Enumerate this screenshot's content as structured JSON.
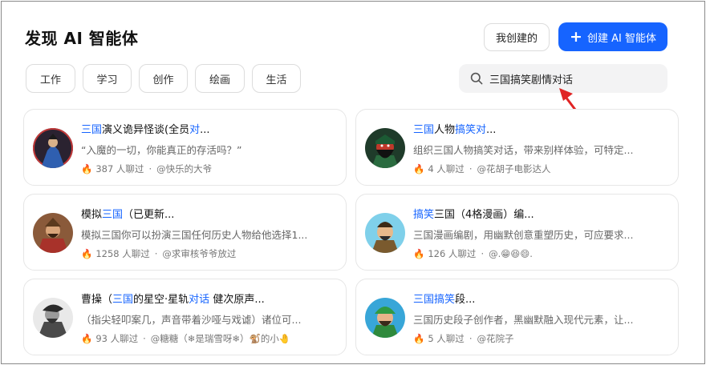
{
  "header": {
    "title": "发现 AI 智能体",
    "my_created_label": "我创建的",
    "create_label": "创建 AI 智能体"
  },
  "tabs": [
    {
      "label": "工作"
    },
    {
      "label": "学习"
    },
    {
      "label": "创作"
    },
    {
      "label": "绘画"
    },
    {
      "label": "生活"
    }
  ],
  "search": {
    "value": "三国搞笑剧情对话"
  },
  "colors": {
    "accent": "#1664ff",
    "arrow": "#e02424",
    "highlight": "#1664ff"
  },
  "cards": [
    {
      "title_parts": [
        {
          "t": "三国",
          "hl": true
        },
        {
          "t": "演义诡异怪谈(全员",
          "hl": false
        },
        {
          "t": "对",
          "hl": true
        },
        {
          "t": "...",
          "hl": false
        }
      ],
      "desc": "“入魔的一切，你能真正的存活吗？”",
      "chats": "387 人聊过",
      "author": "@快乐的大爷",
      "avatar_icon": "blue-robed-figure-avatar"
    },
    {
      "title_parts": [
        {
          "t": "三国",
          "hl": true
        },
        {
          "t": "人物",
          "hl": false
        },
        {
          "t": "搞笑对",
          "hl": true
        },
        {
          "t": "...",
          "hl": false
        }
      ],
      "desc": "组织三国人物搞笑对话，带来别样体验，可特定...",
      "chats": "4 人聊过",
      "author": "@花胡子电影达人",
      "avatar_icon": "red-faced-general-avatar"
    },
    {
      "title_parts": [
        {
          "t": "模拟",
          "hl": false
        },
        {
          "t": "三国",
          "hl": true
        },
        {
          "t": "（已更新...",
          "hl": false
        }
      ],
      "desc": "模拟三国你可以扮演三国任何历史人物给他选择1...",
      "chats": "1258 人聊过",
      "author": "@求审核爷爷放过",
      "avatar_icon": "warrior-portrait-avatar"
    },
    {
      "title_parts": [
        {
          "t": "搞笑",
          "hl": true
        },
        {
          "t": "三国（4格漫画）编...",
          "hl": false
        }
      ],
      "desc": "三国漫画编剧，用幽默创意重塑历史，可应要求...",
      "chats": "126 人聊过",
      "author": "@.😁😆😄.",
      "avatar_icon": "cartoon-general-avatar"
    },
    {
      "title_parts": [
        {
          "t": "曹操（",
          "hl": false
        },
        {
          "t": "三国",
          "hl": true
        },
        {
          "t": "的星空·星轨",
          "hl": false
        },
        {
          "t": "对话",
          "hl": true
        },
        {
          "t": " 健次原声...",
          "hl": false
        }
      ],
      "desc": "（指尖轻叩案几，声音带着沙哑与戏谑）诸位可...",
      "chats": "93 人聊过",
      "author": "@糖糖（❄是瑞雪呀❄）🐒的小🤚",
      "avatar_icon": "ink-sketch-avatar"
    },
    {
      "title_parts": [
        {
          "t": "三国搞笑",
          "hl": true
        },
        {
          "t": "段...",
          "hl": false
        }
      ],
      "desc": "三国历史段子创作者，黑幽默融入现代元素，让...",
      "chats": "5 人聊过",
      "author": "@花院子",
      "avatar_icon": "green-helmet-general-avatar"
    }
  ]
}
